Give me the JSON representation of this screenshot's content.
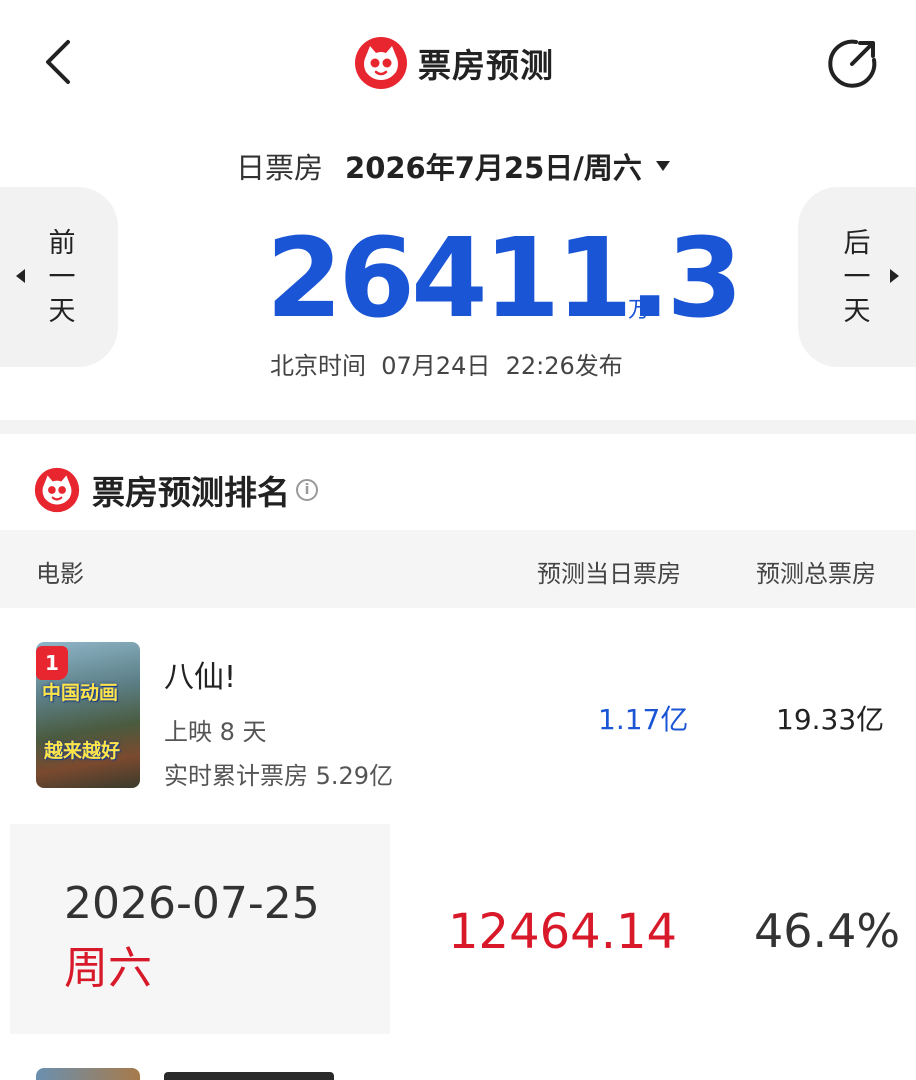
{
  "header": {
    "title": "票房预测",
    "back_icon": "chevron-left-icon",
    "share_icon": "share-icon",
    "brand_color": "#e8262f"
  },
  "date_selector": {
    "label": "日票房",
    "value": "2026年7月25日/周六"
  },
  "nav": {
    "prev_label": "前一天",
    "next_label": "后一天"
  },
  "summary": {
    "box_office": "26411.3",
    "unit": "万",
    "publish_prefix": "北京时间",
    "publish_date": "07月24日",
    "publish_time": "22:26发布",
    "accent_color": "#1a55d6"
  },
  "ranking": {
    "title": "票房预测排名",
    "info_icon": "info-icon",
    "columns": [
      "电影",
      "预测当日票房",
      "预测总票房"
    ],
    "rows": [
      {
        "rank": "1",
        "title": "八仙!",
        "days": "上映 8 天",
        "cumulative": "实时累计票房 5.29亿",
        "predicted_day": "1.17亿",
        "predicted_total": "19.33亿",
        "poster_line1": "中国动画",
        "poster_line2": "越来越好"
      }
    ]
  },
  "prediction_card": {
    "date": "2026-07-25",
    "weekday": "周六",
    "amount": "12464.14",
    "percent": "46.4%"
  }
}
